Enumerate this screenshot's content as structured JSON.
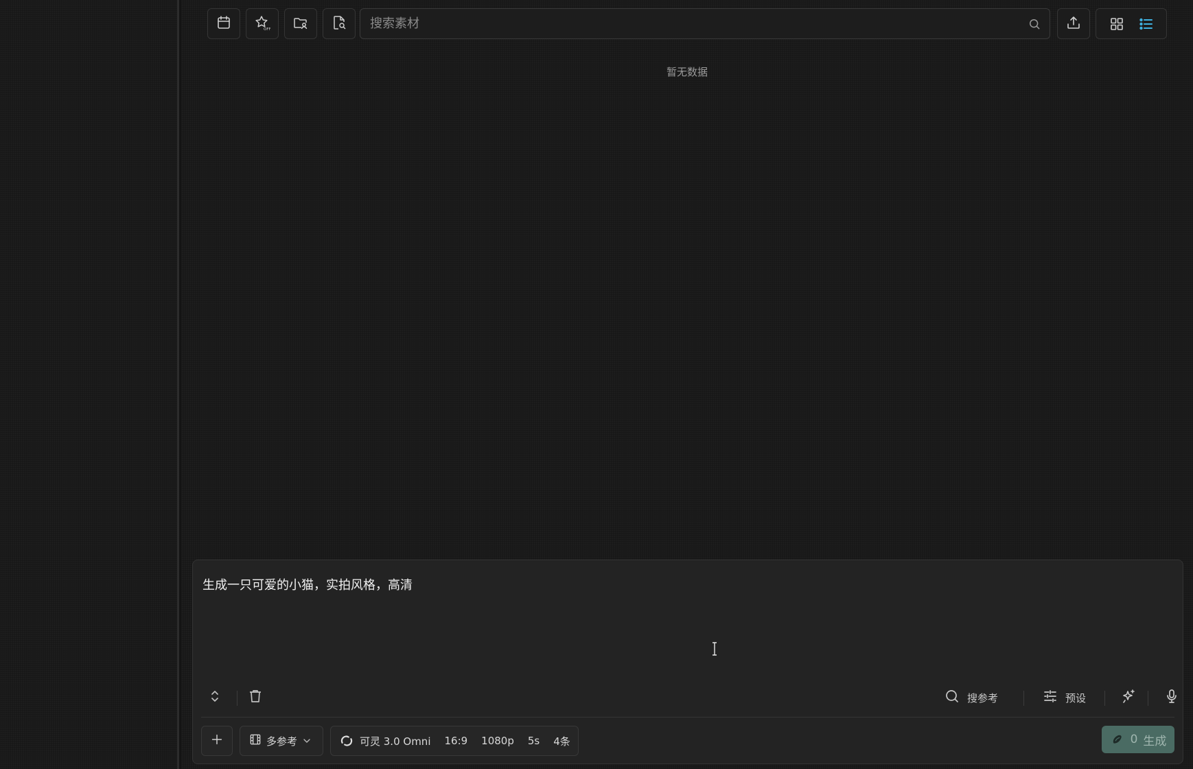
{
  "search": {
    "placeholder": "搜索素材"
  },
  "empty_state": "暂无数据",
  "prompt_text": "生成一只可爱的小猫，实拍风格，高清",
  "tools": {
    "search_ref_label": "搜参考",
    "preset_label": "预设"
  },
  "reference_select": {
    "value": "多参考"
  },
  "model": {
    "name": "可灵 3.0 Omni",
    "ratio": "16:9",
    "resolution": "1080p",
    "duration": "5s",
    "count": "4条"
  },
  "generate": {
    "cost": "0",
    "label": "生成"
  },
  "colors": {
    "background": "#141414",
    "composer": "#232323",
    "generate_button": "#4a6b63",
    "view_active": "#3fb1e0"
  },
  "icons": {
    "toolbar": [
      "calendar-icon",
      "star-off-icon",
      "folder-user-icon",
      "file-search-icon",
      "upload-icon"
    ],
    "view": [
      "grid-view-icon",
      "list-view-icon"
    ]
  }
}
